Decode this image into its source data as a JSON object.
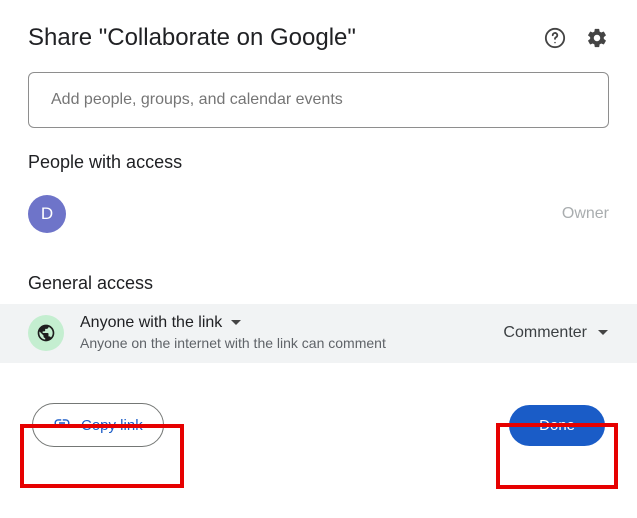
{
  "header": {
    "title": "Share \"Collaborate on Google\""
  },
  "input": {
    "placeholder": "Add people, groups, and calendar events"
  },
  "people": {
    "heading": "People with access",
    "items": [
      {
        "initial": "D",
        "role": "Owner"
      }
    ]
  },
  "general": {
    "heading": "General access",
    "title": "Anyone with the link",
    "description": "Anyone on the internet with the link can comment",
    "role": "Commenter"
  },
  "footer": {
    "copy_label": "Copy link",
    "done_label": "Done"
  }
}
